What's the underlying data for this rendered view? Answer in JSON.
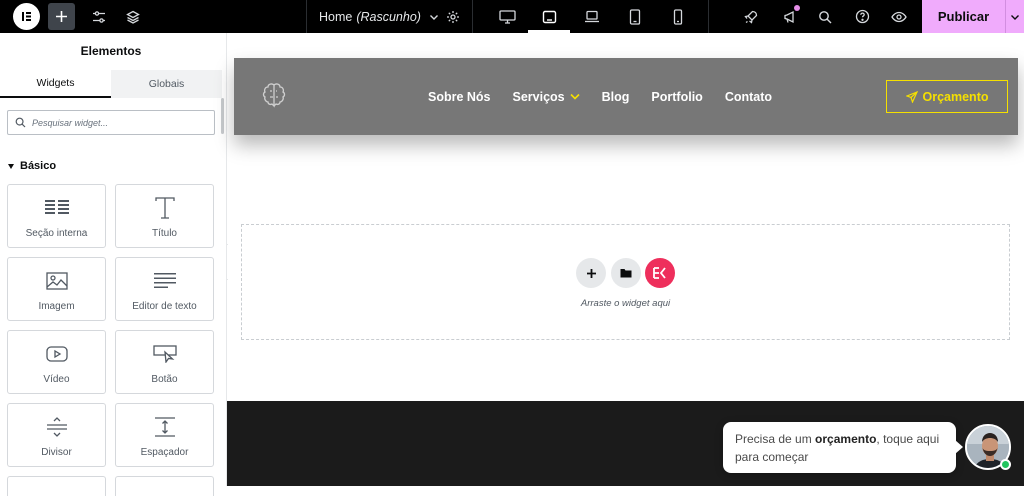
{
  "topbar": {
    "document_name": "Home",
    "document_status": "(Rascunho)",
    "publish_label": "Publicar"
  },
  "panel": {
    "title": "Elementos",
    "tabs": [
      {
        "label": "Widgets",
        "active": true
      },
      {
        "label": "Globais",
        "active": false
      }
    ],
    "search_placeholder": "Pesquisar widget...",
    "section_title": "Básico",
    "widgets": [
      {
        "label": "Seção interna",
        "icon": "inner-section-icon"
      },
      {
        "label": "Título",
        "icon": "heading-icon"
      },
      {
        "label": "Imagem",
        "icon": "image-icon"
      },
      {
        "label": "Editor de texto",
        "icon": "text-editor-icon"
      },
      {
        "label": "Vídeo",
        "icon": "video-icon"
      },
      {
        "label": "Botão",
        "icon": "button-icon"
      },
      {
        "label": "Divisor",
        "icon": "divider-icon"
      },
      {
        "label": "Espaçador",
        "icon": "spacer-icon"
      }
    ]
  },
  "site": {
    "nav": [
      "Sobre Nós",
      "Serviços",
      "Blog",
      "Portfolio",
      "Contato"
    ],
    "cta_label": "Orçamento",
    "accent_color": "#f5e000",
    "header_color": "#777777"
  },
  "dropzone": {
    "hint": "Arraste o widget aqui"
  },
  "chat": {
    "text_before": "Precisa de um ",
    "text_bold": "orçamento",
    "text_after": ", toque aqui para começar"
  },
  "colors": {
    "publish_bg": "#f0abfc",
    "kit_button": "#ee2f5c",
    "online": "#22c55e"
  }
}
